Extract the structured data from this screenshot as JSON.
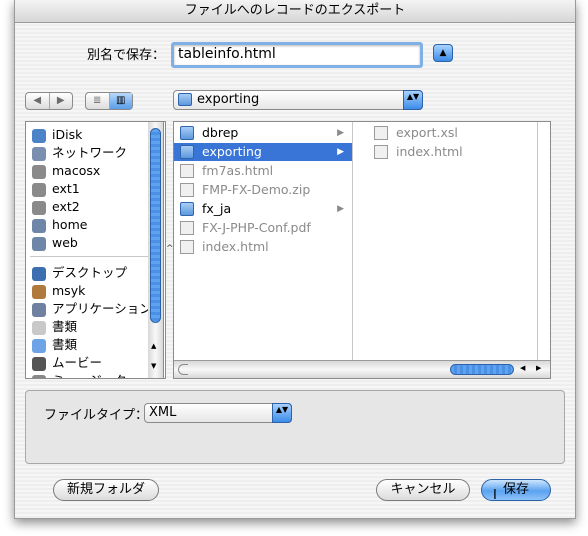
{
  "window": {
    "title": "ファイルへのレコードのエクスポート"
  },
  "save_as": {
    "label": "別名で保存：",
    "value": "tableinfo.html"
  },
  "location": {
    "selected": "exporting"
  },
  "sidebar": {
    "items": [
      {
        "label": "iDisk",
        "icon": "idisk-icon"
      },
      {
        "label": "ネットワーク",
        "icon": "network-icon"
      },
      {
        "label": "macosx",
        "icon": "disk-icon"
      },
      {
        "label": "ext1",
        "icon": "disk-icon"
      },
      {
        "label": "ext2",
        "icon": "disk-icon"
      },
      {
        "label": "home",
        "icon": "network-volume-icon"
      },
      {
        "label": "web",
        "icon": "network-volume-icon"
      },
      {
        "label": "デスクトップ",
        "icon": "desktop-icon"
      },
      {
        "label": "msyk",
        "icon": "home-icon"
      },
      {
        "label": "アプリケーション",
        "icon": "applications-icon"
      },
      {
        "label": "書類",
        "icon": "documents-icon"
      },
      {
        "label": "書類",
        "icon": "folder-icon"
      },
      {
        "label": "ムービー",
        "icon": "movies-icon"
      },
      {
        "label": "ミュージック",
        "icon": "music-icon"
      }
    ]
  },
  "browser": {
    "column1": [
      {
        "label": "dbrep",
        "type": "folder",
        "arrow": "▶"
      },
      {
        "label": "exporting",
        "type": "folder",
        "arrow": "▶",
        "selected": true
      },
      {
        "label": "fm7as.html",
        "type": "file"
      },
      {
        "label": "FMP-FX-Demo.zip",
        "type": "file"
      },
      {
        "label": "fx_ja",
        "type": "folder",
        "arrow": "▶"
      },
      {
        "label": "FX-J-PHP-Conf.pdf",
        "type": "file"
      },
      {
        "label": "index.html",
        "type": "file"
      }
    ],
    "column2": [
      {
        "label": "export.xsl",
        "type": "file"
      },
      {
        "label": "index.html",
        "type": "file"
      }
    ]
  },
  "file_type": {
    "label": "ファイルタイプ：",
    "value": "XML"
  },
  "buttons": {
    "new_folder": "新規フォルダ",
    "cancel": "キャンセル",
    "save": "保存"
  },
  "icons": {
    "collapse": "▲",
    "popup_arrows": "▲▼",
    "back": "◀",
    "forward": "▶",
    "list_view": "≣",
    "column_view": "▥",
    "scroll_up": "▲",
    "scroll_down": "▼",
    "scroll_left": "◀",
    "scroll_right": "▶",
    "caret": "^"
  }
}
